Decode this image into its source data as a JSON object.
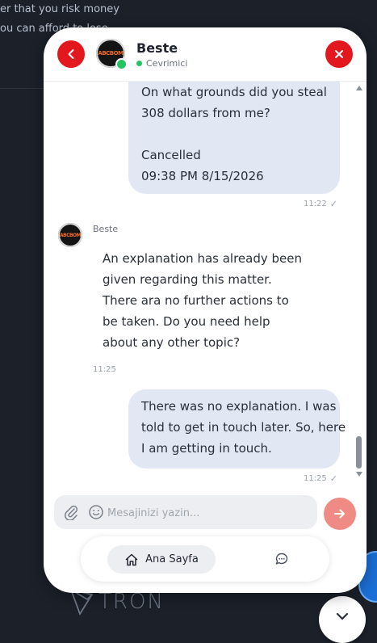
{
  "background": {
    "line1": "er that you risk money",
    "line2": "ou can afford to lose",
    "brand": "TRON"
  },
  "header": {
    "agent_name": "Beste",
    "agent_status": "Cevrimici",
    "avatar_label": "ABCBOM",
    "back_icon": "chevron-left-icon",
    "close_icon": "close-icon"
  },
  "messages": [
    {
      "from": "user",
      "lines": [
        "On what grounds did you steal",
        "308 dollars from me?",
        "",
        "Cancelled",
        "09:38 PM 8/15/2026"
      ],
      "time": "11:22",
      "status": "✓"
    },
    {
      "from": "agent",
      "sender": "Beste",
      "lines": [
        "An explanation has already been",
        "given regarding this matter.",
        "There ara no further actions to",
        "be taken. Do you need help",
        "about any other topic?"
      ],
      "time": "11:25"
    },
    {
      "from": "user",
      "lines": [
        "There was no explanation. I was",
        "told to get in touch later. So, here",
        "I am getting in touch."
      ],
      "time": "11:25",
      "status": "✓"
    }
  ],
  "composer": {
    "placeholder": "Mesajinizi yazin...",
    "value": ""
  },
  "nav": {
    "home_label": "Ana Sayfa"
  },
  "colors": {
    "accent": "#e3181e",
    "user_bubble": "#e2e7f4",
    "send": "#f08a84",
    "online": "#22c55e"
  }
}
